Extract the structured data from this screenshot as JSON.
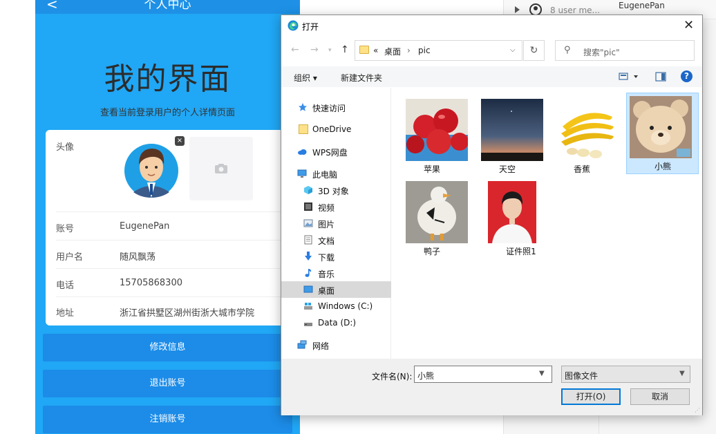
{
  "profile_page": {
    "back_glyph": "<",
    "header_title": "个人中心",
    "big_title": "我的界面",
    "subtitle": "查看当前登录用户的个人详情页面",
    "avatar_label": "头像",
    "avatar_remove": "×",
    "fields": [
      {
        "label": "账号",
        "value": "EugenePan"
      },
      {
        "label": "用户名",
        "value": "随风飘荡"
      },
      {
        "label": "电话",
        "value": "15705868300"
      },
      {
        "label": "地址",
        "value": "浙江省拱墅区湖州街浙大城市学院"
      }
    ],
    "buttons": [
      "修改信息",
      "退出账号",
      "注销账号"
    ],
    "colors": {
      "background": "#20a7f5",
      "button": "#1c8ce8"
    }
  },
  "background_list": {
    "row_text": "8 user me...",
    "name": "EugenePan"
  },
  "dialog": {
    "title": "打开",
    "close_glyph": "✕",
    "address": {
      "prefix": "«",
      "path": [
        "桌面",
        "pic"
      ],
      "separator": "›"
    },
    "refresh_glyph": "↻",
    "search_placeholder": "搜索\"pic\"",
    "toolbar": {
      "organize": "组织 ▾",
      "new_folder": "新建文件夹",
      "help": "?"
    },
    "nav_items": [
      {
        "label": "快速访问",
        "icon": "star-icon"
      },
      {
        "label": "OneDrive",
        "icon": "folder-icon"
      },
      {
        "label": "WPS网盘",
        "icon": "cloud-icon"
      },
      {
        "label": "此电脑",
        "icon": "computer-icon"
      },
      {
        "label": "3D 对象",
        "icon": "cube-icon"
      },
      {
        "label": "视频",
        "icon": "video-icon"
      },
      {
        "label": "图片",
        "icon": "picture-icon"
      },
      {
        "label": "文档",
        "icon": "document-icon"
      },
      {
        "label": "下载",
        "icon": "download-icon"
      },
      {
        "label": "音乐",
        "icon": "music-icon"
      },
      {
        "label": "桌面",
        "icon": "desktop-icon",
        "selected": true
      },
      {
        "label": "Windows (C:)",
        "icon": "drive-icon"
      },
      {
        "label": "Data (D:)",
        "icon": "drive-icon"
      },
      {
        "label": "网络",
        "icon": "network-icon"
      }
    ],
    "files": [
      {
        "name": "苹果"
      },
      {
        "name": "天空"
      },
      {
        "name": "香蕉"
      },
      {
        "name": "小熊",
        "selected": true
      },
      {
        "name": "鸭子"
      },
      {
        "name": "证件照1"
      }
    ],
    "filename_label": "文件名(N):",
    "filename_value": "小熊",
    "filetype": "图像文件",
    "open_button": "打开(O)",
    "cancel_button": "取消"
  }
}
